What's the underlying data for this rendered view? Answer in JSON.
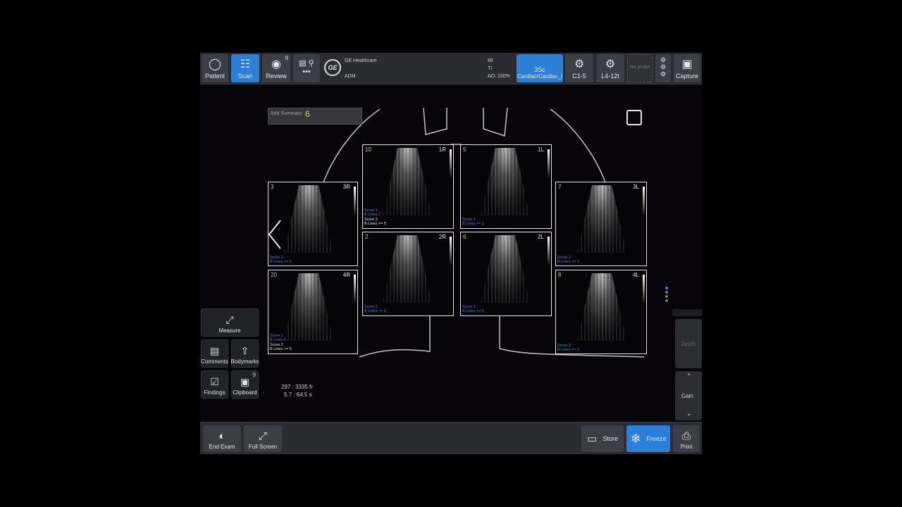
{
  "topbar": {
    "patient_label": "Patient",
    "scan_label": "Scan",
    "review_label": "Review",
    "review_count": "9",
    "brand": "GE Healthcare",
    "logo_text": "GE",
    "user": "ADM",
    "mi": "MI",
    "ti": "TI",
    "ao": "AO: 100%",
    "probe_active_name": "3Sc",
    "probe_active_preset": "Cardiac/Cardiac_l",
    "probe2": "C1-5",
    "probe3": "L4-12t",
    "probe4": "No probe",
    "capture_label": "Capture",
    "more_dots": "•••"
  },
  "summary": {
    "placeholder": "Add Summary",
    "score": "6"
  },
  "tiles": [
    {
      "num": "3",
      "zone": "3R",
      "lines": [
        "Score 2",
        "B Lines >= 5"
      ]
    },
    {
      "num": "10",
      "zone": "1R",
      "lines": [
        "Score 1",
        "B Lines 2",
        "Score 2",
        "B Lines >= 5"
      ]
    },
    {
      "num": "5",
      "zone": "1L",
      "lines": [
        "Score 2",
        "B Lines >= 5"
      ]
    },
    {
      "num": "7",
      "zone": "3L",
      "lines": [
        "Score 2",
        "B Lines >= 5"
      ]
    },
    {
      "num": "20",
      "zone": "4R",
      "lines": [
        "Score 1",
        "B Lines 2",
        "Score 2",
        "B Lines >= 5"
      ]
    },
    {
      "num": "2",
      "zone": "2R",
      "lines": [
        "Score 2",
        "B Lines >= 5"
      ]
    },
    {
      "num": "6",
      "zone": "2L",
      "lines": [
        "Score 2",
        "B Lines >= 5"
      ]
    },
    {
      "num": "8",
      "zone": "4L",
      "lines": [
        "Score 2",
        "B Lines >= 5"
      ]
    }
  ],
  "tools": {
    "measure": "Measure",
    "comments": "Comments",
    "bodymarks": "Bodymarks",
    "findings": "Findings",
    "clipboard": "Clipboard",
    "clipboard_count": "9"
  },
  "frames": {
    "line1": "297 : 3335 fr",
    "line2": "5.7 : 64.5 s"
  },
  "right": {
    "depth": "Depth",
    "gain": "Gain"
  },
  "bottombar": {
    "end_exam": "End Exam",
    "full_screen": "Full Screen",
    "store": "Store",
    "freeze": "Freeze",
    "print": "Print"
  },
  "colors": {
    "accent": "#2c7fd6",
    "score_yellow": "#e1c85a",
    "label_blue": "#4d82d8"
  }
}
